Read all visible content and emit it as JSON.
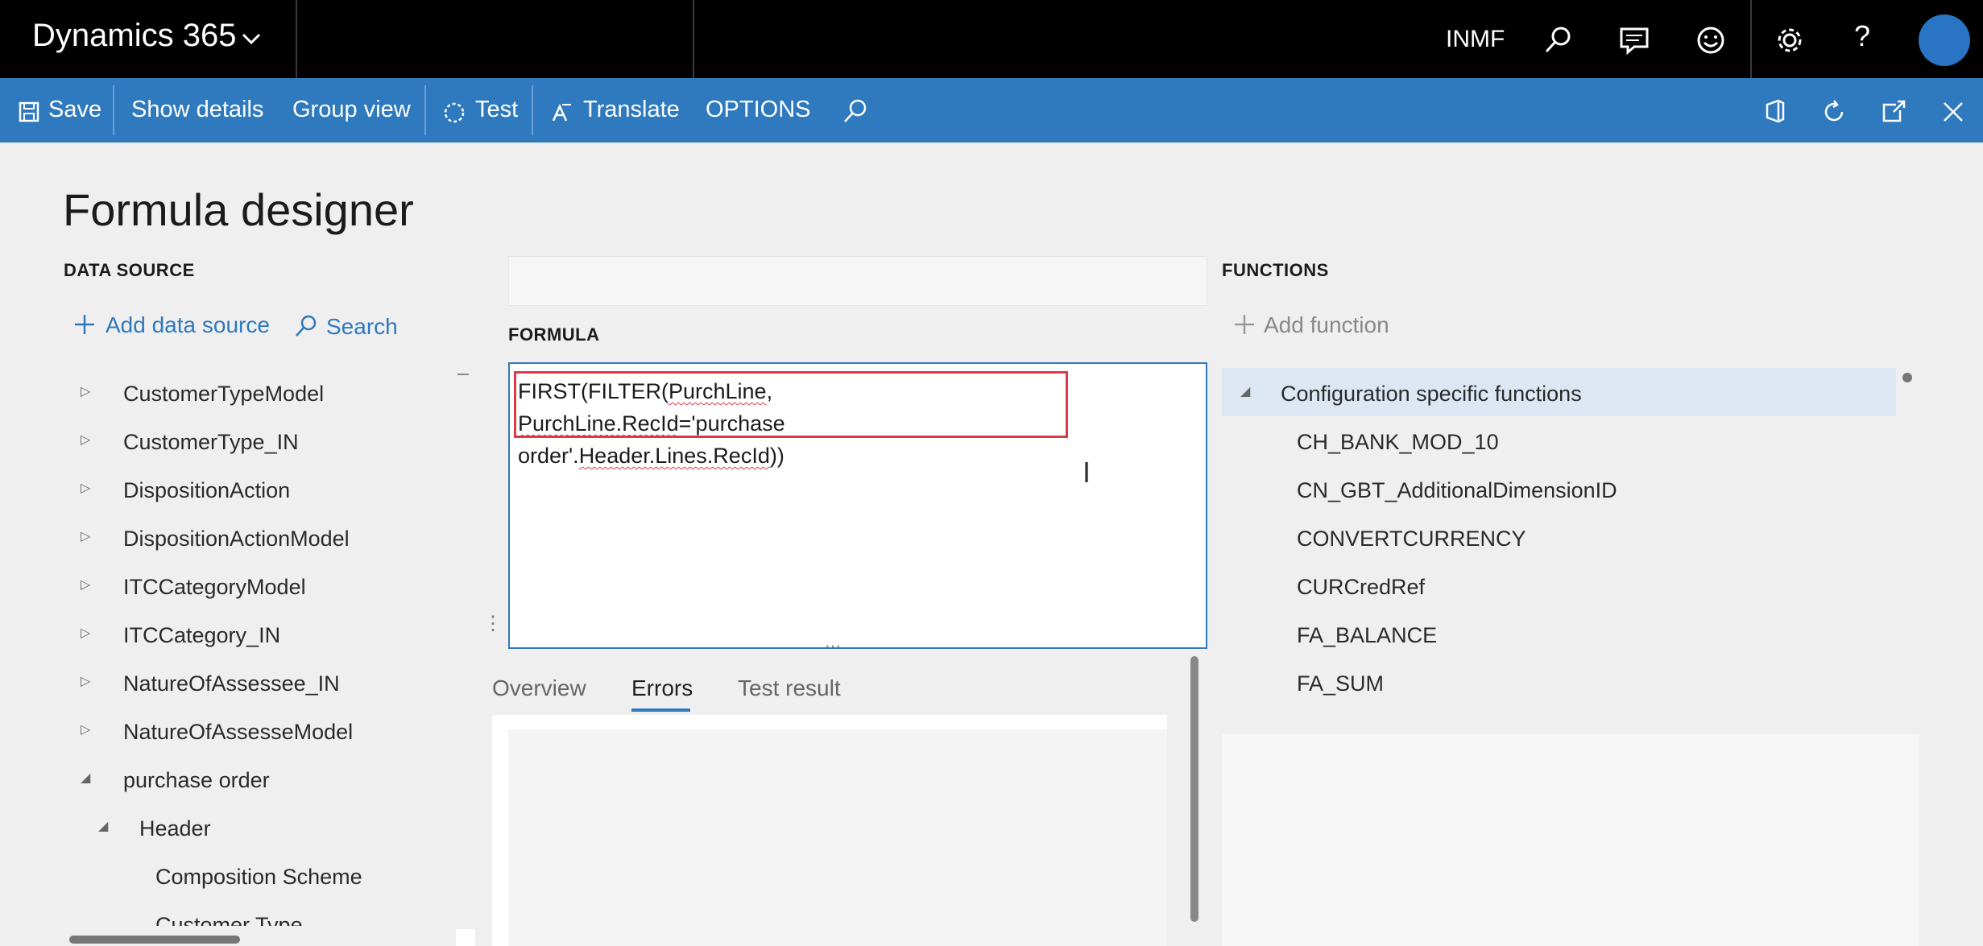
{
  "topbar": {
    "app_title": "Dynamics 365",
    "company": "INMF"
  },
  "icons": {
    "chevron": "chevron-down-icon",
    "search": "search-icon",
    "feedback": "chat-icon",
    "smiley": "smiley-icon",
    "settings": "gear-icon",
    "help": "help-icon"
  },
  "actionbar": {
    "save": "Save",
    "show_details": "Show details",
    "group_view": "Group view",
    "test": "Test",
    "translate": "Translate",
    "options": "OPTIONS"
  },
  "page": {
    "title": "Formula designer"
  },
  "data_source": {
    "heading": "DATA SOURCE",
    "add_label": "Add data source",
    "search_label": "Search",
    "items": [
      {
        "label": "CustomerTypeModel",
        "expanded": false
      },
      {
        "label": "CustomerType_IN",
        "expanded": false
      },
      {
        "label": "DispositionAction",
        "expanded": false
      },
      {
        "label": "DispositionActionModel",
        "expanded": false
      },
      {
        "label": "ITCCategoryModel",
        "expanded": false
      },
      {
        "label": "ITCCategory_IN",
        "expanded": false
      },
      {
        "label": "NatureOfAssessee_IN",
        "expanded": false
      },
      {
        "label": "NatureOfAssesseModel",
        "expanded": false
      },
      {
        "label": "purchase order",
        "expanded": true
      },
      {
        "label": "Header",
        "expanded": true
      },
      {
        "label": "Composition Scheme",
        "expanded": false
      },
      {
        "label": "Customer Type",
        "expanded": false
      }
    ]
  },
  "formula": {
    "heading": "FORMULA",
    "part1": "FIRST(FILTER(",
    "tok1": "PurchLine",
    "part2": ", ",
    "tok2": "PurchLine.RecId",
    "part3": "='purchase order'.",
    "tok3": "Header.Lines.RecId",
    "part4": "))"
  },
  "tabs": {
    "overview": "Overview",
    "errors": "Errors",
    "test_result": "Test result",
    "active": "Errors"
  },
  "functions": {
    "heading": "FUNCTIONS",
    "add_label": "Add function",
    "group": "Configuration specific functions",
    "items": [
      "CH_BANK_MOD_10",
      "CN_GBT_AdditionalDimensionID",
      "CONVERTCURRENCY",
      "CURCredRef",
      "FA_BALANCE",
      "FA_SUM"
    ]
  }
}
